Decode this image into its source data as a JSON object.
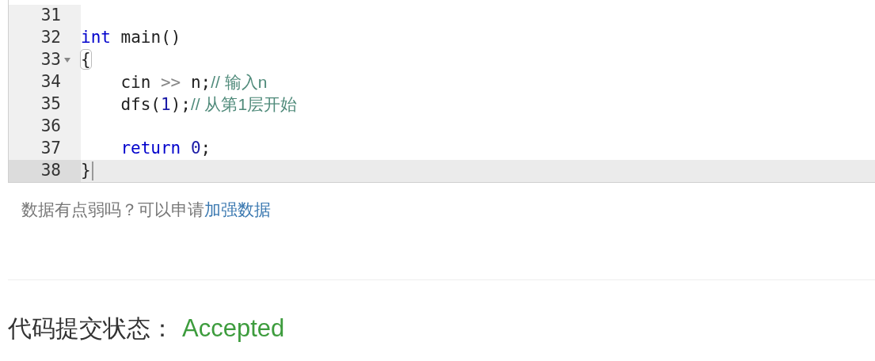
{
  "editor": {
    "lines": [
      {
        "number": "31",
        "foldable": false,
        "active": false
      },
      {
        "number": "32",
        "foldable": false,
        "active": false,
        "indented": false,
        "tokens": [
          {
            "kind": "keyword",
            "text": "int"
          },
          {
            "kind": "plain",
            "text": "main()"
          }
        ]
      },
      {
        "number": "33",
        "foldable": true,
        "active": false,
        "indented": false,
        "tokens": [
          {
            "kind": "bracket",
            "text": "{"
          }
        ]
      },
      {
        "number": "34",
        "foldable": false,
        "active": false,
        "indented": true,
        "tokens": [
          {
            "kind": "plain",
            "text": "cin"
          },
          {
            "kind": "operator",
            "text": ">>"
          },
          {
            "kind": "plain",
            "text": "n;"
          },
          {
            "kind": "comment",
            "text": "// 输入n"
          }
        ]
      },
      {
        "number": "35",
        "foldable": false,
        "active": false,
        "indented": true,
        "tokens": [
          {
            "kind": "plain",
            "text": "dfs("
          },
          {
            "kind": "number",
            "text": "1"
          },
          {
            "kind": "plain",
            "text": ");"
          },
          {
            "kind": "comment",
            "text": "// 从第1层开始"
          }
        ]
      },
      {
        "number": "36",
        "foldable": false,
        "active": false
      },
      {
        "number": "37",
        "foldable": false,
        "active": false,
        "indented": true,
        "tokens": [
          {
            "kind": "keyword",
            "text": "return"
          },
          {
            "kind": "number",
            "text": "0"
          },
          {
            "kind": "plain",
            "text": ";"
          }
        ]
      },
      {
        "number": "38",
        "foldable": false,
        "active": true,
        "indented": false,
        "tokens": [
          {
            "kind": "plain",
            "text": "}"
          }
        ]
      }
    ]
  },
  "data_hint": {
    "text": "数据有点弱吗？可以申请",
    "link": "加强数据"
  },
  "submission": {
    "label": "代码提交状态：",
    "status": "Accepted"
  }
}
